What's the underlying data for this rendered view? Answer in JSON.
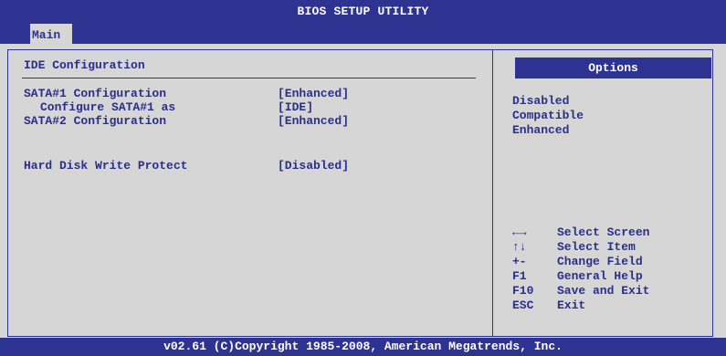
{
  "app": {
    "title": "BIOS SETUP UTILITY",
    "tab": "Main"
  },
  "section": {
    "title": "IDE Configuration"
  },
  "settings": [
    {
      "label": "SATA#1 Configuration",
      "value": "[Enhanced]"
    },
    {
      "label": "Configure SATA#1 as",
      "value": "[IDE]"
    },
    {
      "label": "SATA#2 Configuration",
      "value": "[Enhanced]"
    },
    {
      "label": "Hard Disk Write Protect",
      "value": "[Disabled]"
    }
  ],
  "options": {
    "title": "Options",
    "items": [
      "Disabled",
      "Compatible",
      "Enhanced"
    ]
  },
  "help": [
    {
      "key": "←→",
      "desc": "Select Screen"
    },
    {
      "key": "↑↓",
      "desc": "Select Item"
    },
    {
      "key": "+-",
      "desc": "Change Field"
    },
    {
      "key": "F1",
      "desc": "General Help"
    },
    {
      "key": "F10",
      "desc": "Save and Exit"
    },
    {
      "key": "ESC",
      "desc": "Exit"
    }
  ],
  "footer": "v02.61 (C)Copyright 1985-2008, American Megatrends, Inc.",
  "colors": {
    "accent": "#2e3291",
    "background": "#d6d6d6",
    "text": "#2b2f8a"
  }
}
